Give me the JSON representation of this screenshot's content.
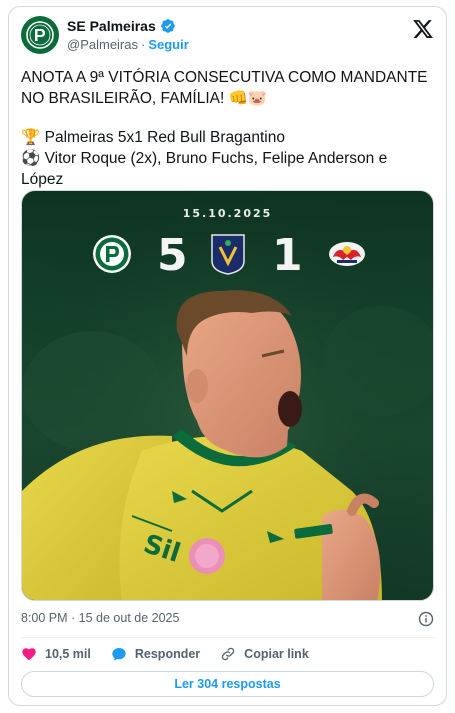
{
  "account": {
    "display_name": "SE Palmeiras",
    "handle": "@Palmeiras",
    "separator": "·",
    "follow_label": "Seguir",
    "verified": true,
    "avatar_icon": "palmeiras-crest-icon"
  },
  "tweet": {
    "line1": "ANOTA A 9ª VITÓRIA CONSECUTIVA COMO MANDANTE",
    "line2": "NO BRASILEIRÃO, FAMÍLIA! 👊🐷",
    "line3": "🏆 Palmeiras 5x1 Red Bull Bragantino",
    "line4": "⚽ Vitor Roque (2x), Bruno Fuchs, Felipe Anderson e",
    "line5": "López"
  },
  "media": {
    "date": "15.10.2025",
    "home_score": "5",
    "away_score": "1",
    "home_crest": "palmeiras-crest-icon",
    "competition_logo": "brasileirao-logo-icon",
    "away_crest": "red-bull-bragantino-crest-icon",
    "sponsor_text": "Sil",
    "colors": {
      "palmeiras_green": "#0b6b3a",
      "jersey_yellow": "#e3d23a",
      "background": "#15432c"
    }
  },
  "meta": {
    "timestamp": "8:00 PM · 15 de out de 2025"
  },
  "actions": {
    "likes_count": "10,5 mil",
    "reply_label": "Responder",
    "copy_link_label": "Copiar link"
  },
  "replies": {
    "read_label": "Ler 304 respostas"
  },
  "accent_color": "#1d9bf0"
}
